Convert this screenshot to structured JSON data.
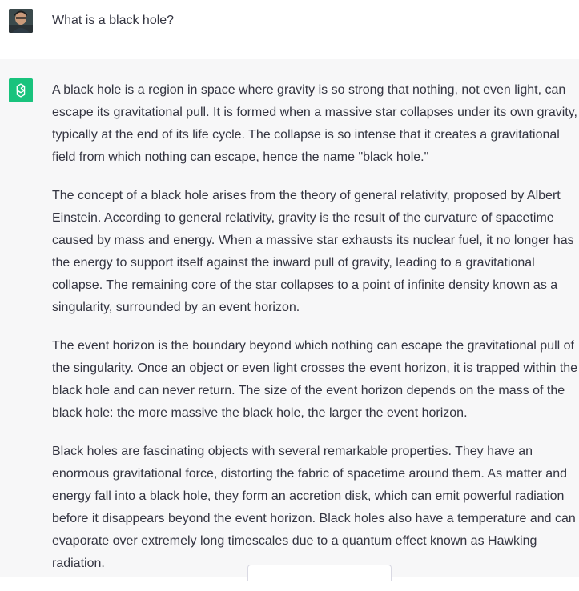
{
  "user_message": {
    "text": "What is a black hole?",
    "avatar": "user-photo"
  },
  "assistant_message": {
    "icon": "chatgpt-logo",
    "paragraphs": [
      "A black hole is a region in space where gravity is so strong that nothing, not even light, can escape its gravitational pull. It is formed when a massive star collapses under its own gravity, typically at the end of its life cycle. The collapse is so intense that it creates a gravitational field from which nothing can escape, hence the name \"black hole.\"",
      "The concept of a black hole arises from the theory of general relativity, proposed by Albert Einstein. According to general relativity, gravity is the result of the curvature of spacetime caused by mass and energy. When a massive star exhausts its nuclear fuel, it no longer has the energy to support itself against the inward pull of gravity, leading to a gravitational collapse. The remaining core of the star collapses to a point of infinite density known as a singularity, surrounded by an event horizon.",
      "The event horizon is the boundary beyond which nothing can escape the gravitational pull of the singularity. Once an object or even light crosses the event horizon, it is trapped within the black hole and can never return. The size of the event horizon depends on the mass of the black hole: the more massive the black hole, the larger the event horizon.",
      "Black holes are fascinating objects with several remarkable properties. They have an enormous gravitational force, distorting the fabric of spacetime around them. As matter and energy fall into a black hole, they form an accretion disk, which can emit powerful radiation before it disappears beyond the event horizon. Black holes also have a temperature and can evaporate over extremely long timescales due to a quantum effect known as Hawking radiation."
    ]
  },
  "colors": {
    "accent": "#19c37d",
    "assistant_bg": "#f7f7f8",
    "text": "#343541"
  }
}
